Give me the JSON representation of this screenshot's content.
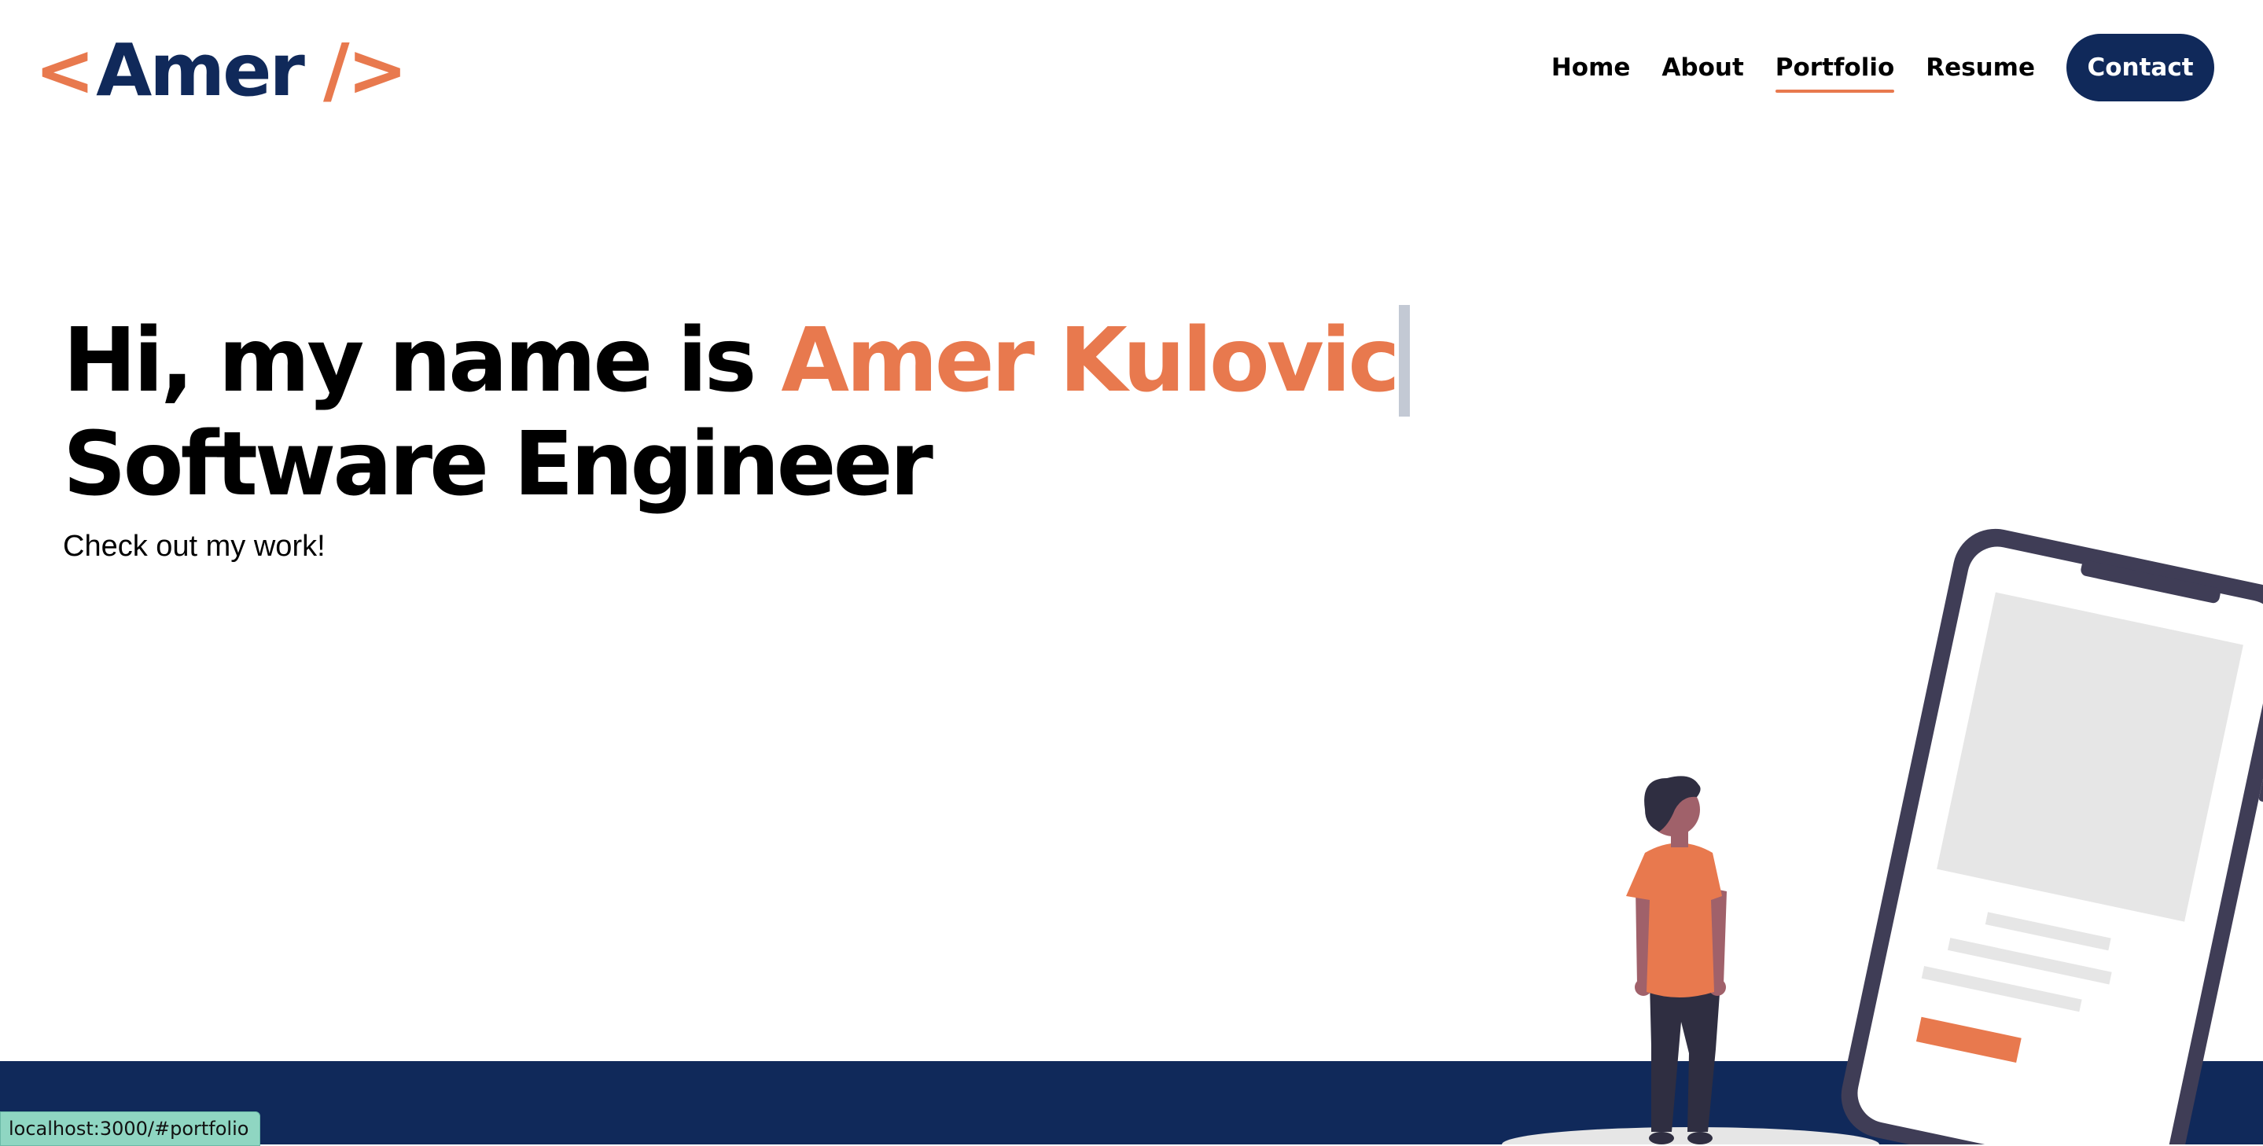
{
  "logo": {
    "open_bracket": "<",
    "name": "Amer",
    "close": "/>"
  },
  "nav": {
    "items": [
      {
        "label": "Home"
      },
      {
        "label": "About"
      },
      {
        "label": "Portfolio",
        "active": true
      },
      {
        "label": "Resume"
      }
    ],
    "contact_label": "Contact"
  },
  "hero": {
    "greeting": "Hi, my name is ",
    "name": "Amer Kulovic",
    "title": "Software Engineer",
    "subtitle": "Check out my work!"
  },
  "status_bar": {
    "url": "localhost:3000/#portfolio"
  },
  "icons": {
    "illustration": "person-looking-at-phone-illustration"
  },
  "colors": {
    "accent": "#e8794e",
    "navy": "#10295a",
    "phone_frame": "#3f3d56",
    "status_bg": "#8fd6c2"
  }
}
